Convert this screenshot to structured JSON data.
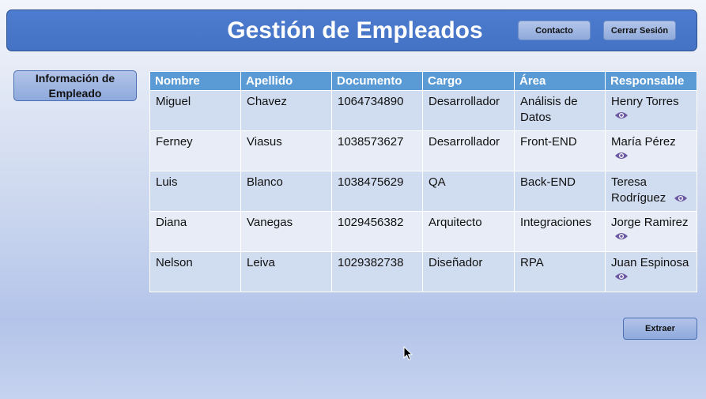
{
  "header": {
    "title": "Gestión de Empleados",
    "contact_label": "Contacto",
    "logout_label": "Cerrar Sesión"
  },
  "sidebar": {
    "info_button_label": "Información de Empleado"
  },
  "table": {
    "columns": [
      "Nombre",
      "Apellido",
      "Documento",
      "Cargo",
      "Área",
      "Responsable"
    ],
    "rows": [
      {
        "nombre": "Miguel",
        "apellido": "Chavez",
        "documento": "1064734890",
        "cargo": "Desarrollador",
        "area": "Análisis de Datos",
        "responsable": "Henry Torres"
      },
      {
        "nombre": "Ferney",
        "apellido": "Viasus",
        "documento": "1038573627",
        "cargo": "Desarrollador",
        "area": "Front-END",
        "responsable": "María Pérez"
      },
      {
        "nombre": "Luis",
        "apellido": "Blanco",
        "documento": "1038475629",
        "cargo": "QA",
        "area": "Back-END",
        "responsable": "Teresa Rodríguez"
      },
      {
        "nombre": "Diana",
        "apellido": "Vanegas",
        "documento": "1029456382",
        "cargo": "Arquitecto",
        "area": "Integraciones",
        "responsable": "Jorge Ramirez"
      },
      {
        "nombre": "Nelson",
        "apellido": "Leiva",
        "documento": "1029382738",
        "cargo": "Diseñador",
        "area": "RPA",
        "responsable": "Juan Espinosa"
      }
    ],
    "row_action_icon": "eye-icon"
  },
  "footer": {
    "extract_label": "Extraer"
  },
  "colors": {
    "header_bg": "#4472c4",
    "table_header_bg": "#5b9bd5",
    "row_odd_bg": "#d0dcef",
    "row_even_bg": "#e7ecf6",
    "button_bg": "#8ea9db"
  }
}
